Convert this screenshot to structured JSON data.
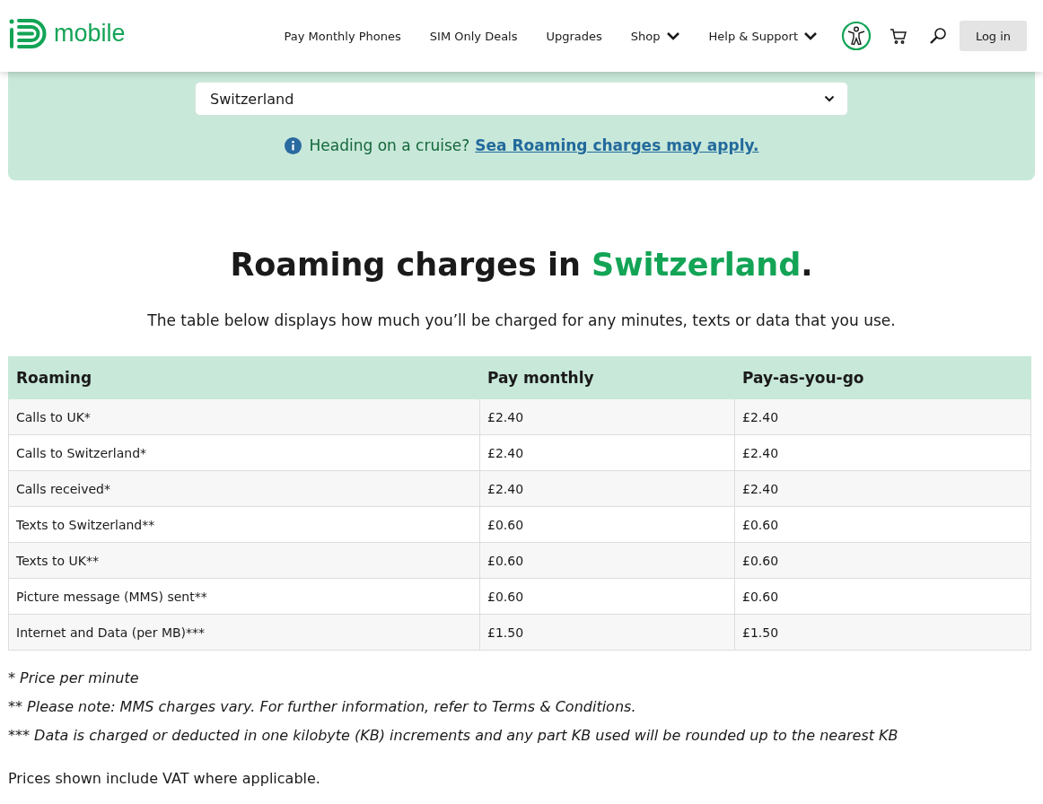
{
  "header": {
    "logo_text": "mobile",
    "nav": [
      {
        "label": "Pay Monthly Phones",
        "dropdown": false
      },
      {
        "label": "SIM Only Deals",
        "dropdown": false
      },
      {
        "label": "Upgrades",
        "dropdown": false
      },
      {
        "label": "Shop",
        "dropdown": true
      },
      {
        "label": "Help & Support",
        "dropdown": true
      }
    ],
    "login": "Log in"
  },
  "country_select": {
    "value": "Switzerland"
  },
  "notice": {
    "text": "Heading on a cruise?",
    "link": "Sea Roaming charges may apply."
  },
  "heading": {
    "before": "Roaming charges in ",
    "country": "Switzerland",
    "after": "."
  },
  "intro": "The table below displays how much you’ll be charged for any minutes, texts or data that you use.",
  "table": {
    "columns": [
      "Roaming",
      "Pay monthly",
      "Pay-as-you-go"
    ],
    "rows": [
      [
        "Calls to UK*",
        "£2.40",
        "£2.40"
      ],
      [
        "Calls to Switzerland*",
        "£2.40",
        "£2.40"
      ],
      [
        "Calls received*",
        "£2.40",
        "£2.40"
      ],
      [
        "Texts to Switzerland**",
        "£0.60",
        "£0.60"
      ],
      [
        "Texts to UK**",
        "£0.60",
        "£0.60"
      ],
      [
        "Picture message (MMS) sent**",
        "£0.60",
        "£0.60"
      ],
      [
        "Internet and Data (per MB)***",
        "£1.50",
        "£1.50"
      ]
    ]
  },
  "footnotes": [
    "* Price per minute",
    "** Please note: MMS charges vary. For further information, refer to Terms & Conditions.",
    "*** Data is charged or deducted in one kilobyte (KB) increments and any part KB used will be rounded up to the nearest KB"
  ],
  "vat_note": "Prices shown include VAT where applicable."
}
